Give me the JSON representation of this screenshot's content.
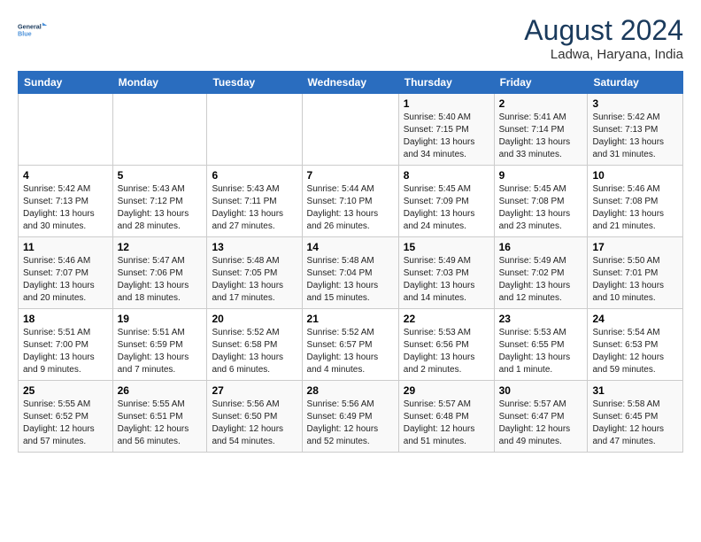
{
  "logo": {
    "line1": "General",
    "line2": "Blue"
  },
  "title": "August 2024",
  "subtitle": "Ladwa, Haryana, India",
  "days_of_week": [
    "Sunday",
    "Monday",
    "Tuesday",
    "Wednesday",
    "Thursday",
    "Friday",
    "Saturday"
  ],
  "weeks": [
    [
      {
        "num": "",
        "info": ""
      },
      {
        "num": "",
        "info": ""
      },
      {
        "num": "",
        "info": ""
      },
      {
        "num": "",
        "info": ""
      },
      {
        "num": "1",
        "info": "Sunrise: 5:40 AM\nSunset: 7:15 PM\nDaylight: 13 hours\nand 34 minutes."
      },
      {
        "num": "2",
        "info": "Sunrise: 5:41 AM\nSunset: 7:14 PM\nDaylight: 13 hours\nand 33 minutes."
      },
      {
        "num": "3",
        "info": "Sunrise: 5:42 AM\nSunset: 7:13 PM\nDaylight: 13 hours\nand 31 minutes."
      }
    ],
    [
      {
        "num": "4",
        "info": "Sunrise: 5:42 AM\nSunset: 7:13 PM\nDaylight: 13 hours\nand 30 minutes."
      },
      {
        "num": "5",
        "info": "Sunrise: 5:43 AM\nSunset: 7:12 PM\nDaylight: 13 hours\nand 28 minutes."
      },
      {
        "num": "6",
        "info": "Sunrise: 5:43 AM\nSunset: 7:11 PM\nDaylight: 13 hours\nand 27 minutes."
      },
      {
        "num": "7",
        "info": "Sunrise: 5:44 AM\nSunset: 7:10 PM\nDaylight: 13 hours\nand 26 minutes."
      },
      {
        "num": "8",
        "info": "Sunrise: 5:45 AM\nSunset: 7:09 PM\nDaylight: 13 hours\nand 24 minutes."
      },
      {
        "num": "9",
        "info": "Sunrise: 5:45 AM\nSunset: 7:08 PM\nDaylight: 13 hours\nand 23 minutes."
      },
      {
        "num": "10",
        "info": "Sunrise: 5:46 AM\nSunset: 7:08 PM\nDaylight: 13 hours\nand 21 minutes."
      }
    ],
    [
      {
        "num": "11",
        "info": "Sunrise: 5:46 AM\nSunset: 7:07 PM\nDaylight: 13 hours\nand 20 minutes."
      },
      {
        "num": "12",
        "info": "Sunrise: 5:47 AM\nSunset: 7:06 PM\nDaylight: 13 hours\nand 18 minutes."
      },
      {
        "num": "13",
        "info": "Sunrise: 5:48 AM\nSunset: 7:05 PM\nDaylight: 13 hours\nand 17 minutes."
      },
      {
        "num": "14",
        "info": "Sunrise: 5:48 AM\nSunset: 7:04 PM\nDaylight: 13 hours\nand 15 minutes."
      },
      {
        "num": "15",
        "info": "Sunrise: 5:49 AM\nSunset: 7:03 PM\nDaylight: 13 hours\nand 14 minutes."
      },
      {
        "num": "16",
        "info": "Sunrise: 5:49 AM\nSunset: 7:02 PM\nDaylight: 13 hours\nand 12 minutes."
      },
      {
        "num": "17",
        "info": "Sunrise: 5:50 AM\nSunset: 7:01 PM\nDaylight: 13 hours\nand 10 minutes."
      }
    ],
    [
      {
        "num": "18",
        "info": "Sunrise: 5:51 AM\nSunset: 7:00 PM\nDaylight: 13 hours\nand 9 minutes."
      },
      {
        "num": "19",
        "info": "Sunrise: 5:51 AM\nSunset: 6:59 PM\nDaylight: 13 hours\nand 7 minutes."
      },
      {
        "num": "20",
        "info": "Sunrise: 5:52 AM\nSunset: 6:58 PM\nDaylight: 13 hours\nand 6 minutes."
      },
      {
        "num": "21",
        "info": "Sunrise: 5:52 AM\nSunset: 6:57 PM\nDaylight: 13 hours\nand 4 minutes."
      },
      {
        "num": "22",
        "info": "Sunrise: 5:53 AM\nSunset: 6:56 PM\nDaylight: 13 hours\nand 2 minutes."
      },
      {
        "num": "23",
        "info": "Sunrise: 5:53 AM\nSunset: 6:55 PM\nDaylight: 13 hours\nand 1 minute."
      },
      {
        "num": "24",
        "info": "Sunrise: 5:54 AM\nSunset: 6:53 PM\nDaylight: 12 hours\nand 59 minutes."
      }
    ],
    [
      {
        "num": "25",
        "info": "Sunrise: 5:55 AM\nSunset: 6:52 PM\nDaylight: 12 hours\nand 57 minutes."
      },
      {
        "num": "26",
        "info": "Sunrise: 5:55 AM\nSunset: 6:51 PM\nDaylight: 12 hours\nand 56 minutes."
      },
      {
        "num": "27",
        "info": "Sunrise: 5:56 AM\nSunset: 6:50 PM\nDaylight: 12 hours\nand 54 minutes."
      },
      {
        "num": "28",
        "info": "Sunrise: 5:56 AM\nSunset: 6:49 PM\nDaylight: 12 hours\nand 52 minutes."
      },
      {
        "num": "29",
        "info": "Sunrise: 5:57 AM\nSunset: 6:48 PM\nDaylight: 12 hours\nand 51 minutes."
      },
      {
        "num": "30",
        "info": "Sunrise: 5:57 AM\nSunset: 6:47 PM\nDaylight: 12 hours\nand 49 minutes."
      },
      {
        "num": "31",
        "info": "Sunrise: 5:58 AM\nSunset: 6:45 PM\nDaylight: 12 hours\nand 47 minutes."
      }
    ]
  ]
}
